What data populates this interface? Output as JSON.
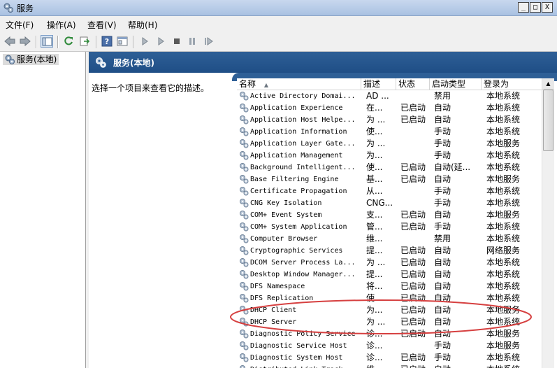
{
  "window": {
    "title": "服务",
    "buttons": [
      "_",
      "□",
      "X"
    ]
  },
  "menu": [
    "文件(F)",
    "操作(A)",
    "查看(V)",
    "帮助(H)"
  ],
  "toolbar_icons": [
    "back-icon",
    "forward-icon",
    "show-tree-icon",
    "refresh-icon",
    "export-icon",
    "help-icon",
    "properties-icon",
    "start-icon",
    "start-alt-icon",
    "stop-icon",
    "pause-icon",
    "restart-icon"
  ],
  "tree": {
    "item": "服务(本地)"
  },
  "panel": {
    "title": "服务(本地)",
    "description": "选择一个项目来查看它的描述。"
  },
  "columns": {
    "name": "名称",
    "desc": "描述",
    "status": "状态",
    "startup": "启动类型",
    "logon": "登录为"
  },
  "services": [
    {
      "name": "Active Directory Domai...",
      "desc": "AD ...",
      "status": "",
      "startup": "禁用",
      "logon": "本地系统"
    },
    {
      "name": "Application Experience",
      "desc": "在...",
      "status": "已启动",
      "startup": "自动",
      "logon": "本地系统"
    },
    {
      "name": "Application Host Helpe...",
      "desc": "为 ...",
      "status": "已启动",
      "startup": "自动",
      "logon": "本地系统"
    },
    {
      "name": "Application Information",
      "desc": "使...",
      "status": "",
      "startup": "手动",
      "logon": "本地系统"
    },
    {
      "name": "Application Layer Gate...",
      "desc": "为 ...",
      "status": "",
      "startup": "手动",
      "logon": "本地服务"
    },
    {
      "name": "Application Management",
      "desc": "为...",
      "status": "",
      "startup": "手动",
      "logon": "本地系统"
    },
    {
      "name": "Background Intelligent...",
      "desc": "使...",
      "status": "已启动",
      "startup": "自动(延...",
      "logon": "本地系统"
    },
    {
      "name": "Base Filtering Engine",
      "desc": "基...",
      "status": "已启动",
      "startup": "自动",
      "logon": "本地服务"
    },
    {
      "name": "Certificate Propagation",
      "desc": "从...",
      "status": "",
      "startup": "手动",
      "logon": "本地系统"
    },
    {
      "name": "CNG Key Isolation",
      "desc": "CNG...",
      "status": "",
      "startup": "手动",
      "logon": "本地系统"
    },
    {
      "name": "COM+ Event System",
      "desc": "支...",
      "status": "已启动",
      "startup": "自动",
      "logon": "本地服务"
    },
    {
      "name": "COM+ System Application",
      "desc": "管...",
      "status": "已启动",
      "startup": "手动",
      "logon": "本地系统"
    },
    {
      "name": "Computer Browser",
      "desc": "维...",
      "status": "",
      "startup": "禁用",
      "logon": "本地系统"
    },
    {
      "name": "Cryptographic Services",
      "desc": "提...",
      "status": "已启动",
      "startup": "自动",
      "logon": "网络服务"
    },
    {
      "name": "DCOM Server Process La...",
      "desc": "为 ...",
      "status": "已启动",
      "startup": "自动",
      "logon": "本地系统"
    },
    {
      "name": "Desktop Window Manager...",
      "desc": "提...",
      "status": "已启动",
      "startup": "自动",
      "logon": "本地系统"
    },
    {
      "name": "DFS Namespace",
      "desc": "将...",
      "status": "已启动",
      "startup": "自动",
      "logon": "本地系统"
    },
    {
      "name": "DFS Replication",
      "desc": "使...",
      "status": "已启动",
      "startup": "自动",
      "logon": "本地系统"
    },
    {
      "name": "DHCP Client",
      "desc": "为...",
      "status": "已启动",
      "startup": "自动",
      "logon": "本地服务"
    },
    {
      "name": "DHCP Server",
      "desc": "为 ...",
      "status": "已启动",
      "startup": "自动",
      "logon": "本地系统"
    },
    {
      "name": "Diagnostic Policy Service",
      "desc": "诊...",
      "status": "已启动",
      "startup": "自动",
      "logon": "本地服务"
    },
    {
      "name": "Diagnostic Service Host",
      "desc": "诊...",
      "status": "",
      "startup": "手动",
      "logon": "本地服务"
    },
    {
      "name": "Diagnostic System Host",
      "desc": "诊...",
      "status": "已启动",
      "startup": "手动",
      "logon": "本地系统"
    },
    {
      "name": "Distributed Link Track...",
      "desc": "维...",
      "status": "已启动",
      "startup": "自动",
      "logon": "本地系统"
    }
  ],
  "highlight": {
    "color": "#d64040",
    "rows": [
      "DHCP Client",
      "DHCP Server"
    ]
  }
}
